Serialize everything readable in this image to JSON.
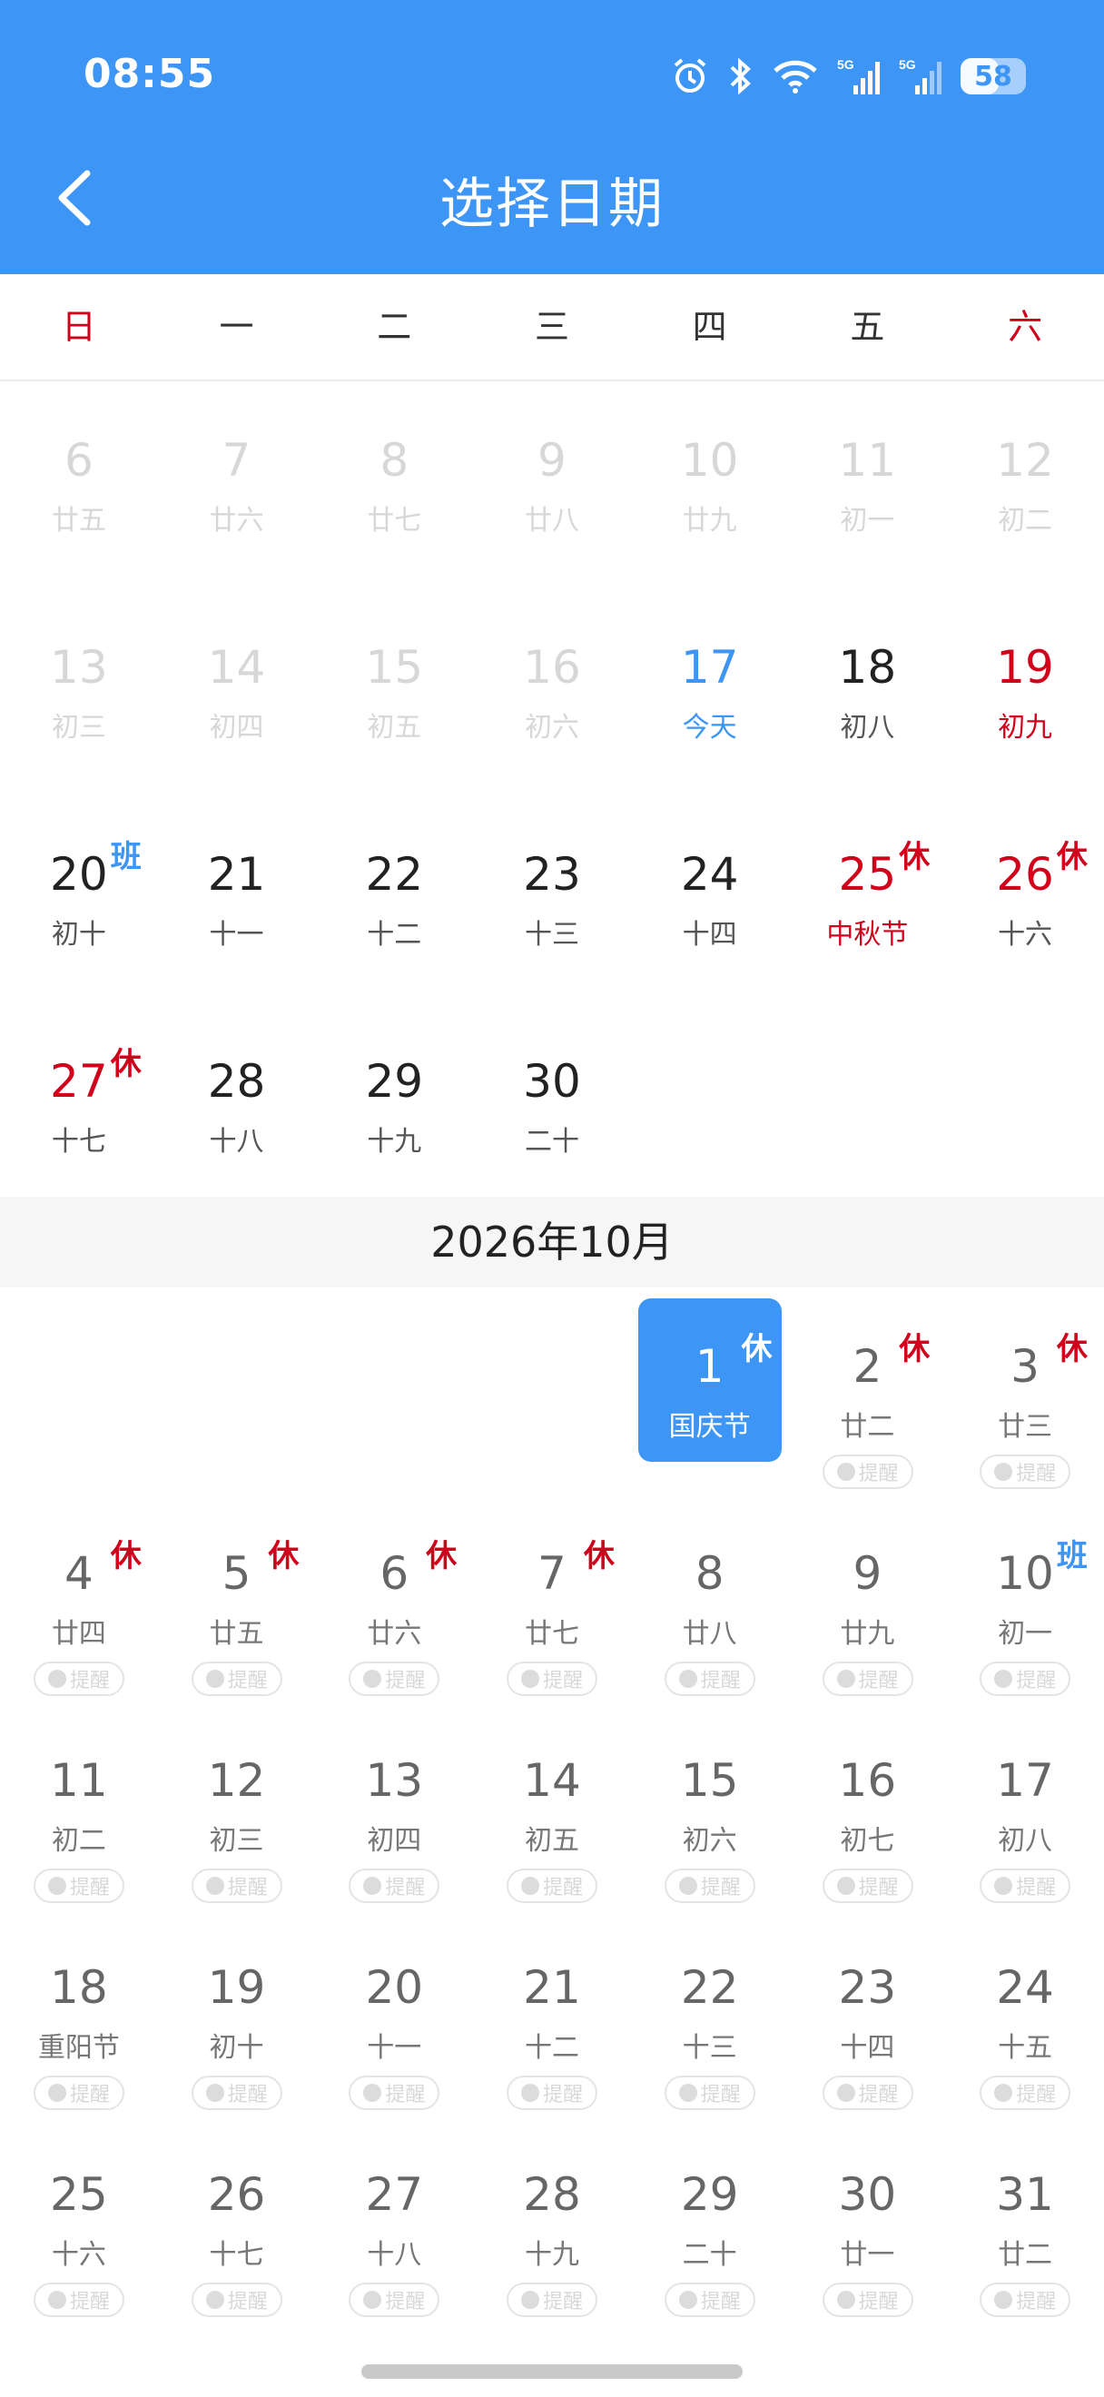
{
  "status_bar": {
    "time": "08:55",
    "battery": "58",
    "battery_fraction": 0.58,
    "signal_label": "5G"
  },
  "header": {
    "title": "选择日期",
    "bg_color": "#3d95f6"
  },
  "weekdays": [
    "日",
    "一",
    "二",
    "三",
    "四",
    "五",
    "六"
  ],
  "tags": {
    "rest": "休",
    "work": "班",
    "remind": "提醒"
  },
  "sept_rows": [
    [
      {
        "day": "6",
        "lunar": "廿五"
      },
      {
        "day": "7",
        "lunar": "廿六"
      },
      {
        "day": "8",
        "lunar": "廿七"
      },
      {
        "day": "9",
        "lunar": "廿八"
      },
      {
        "day": "10",
        "lunar": "廿九"
      },
      {
        "day": "11",
        "lunar": "初一"
      },
      {
        "day": "12",
        "lunar": "初二"
      }
    ],
    [
      {
        "day": "13",
        "lunar": "初三"
      },
      {
        "day": "14",
        "lunar": "初四"
      },
      {
        "day": "15",
        "lunar": "初五"
      },
      {
        "day": "16",
        "lunar": "初六"
      },
      {
        "day": "17",
        "lunar": "今天"
      },
      {
        "day": "18",
        "lunar": "初八"
      },
      {
        "day": "19",
        "lunar": "初九"
      }
    ],
    [
      {
        "day": "20",
        "lunar": "初十"
      },
      {
        "day": "21",
        "lunar": "十一"
      },
      {
        "day": "22",
        "lunar": "十二"
      },
      {
        "day": "23",
        "lunar": "十三"
      },
      {
        "day": "24",
        "lunar": "十四"
      },
      {
        "day": "25",
        "lunar": "中秋节"
      },
      {
        "day": "26",
        "lunar": "十六"
      }
    ],
    [
      {
        "day": "27",
        "lunar": "十七"
      },
      {
        "day": "28",
        "lunar": "十八"
      },
      {
        "day": "29",
        "lunar": "十九"
      },
      {
        "day": "30",
        "lunar": "二十"
      }
    ]
  ],
  "october": {
    "title": "2026年10月",
    "rows": [
      [
        {
          "day": "1",
          "lunar": "国庆节"
        },
        {
          "day": "2",
          "lunar": "廿二"
        },
        {
          "day": "3",
          "lunar": "廿三"
        }
      ],
      [
        {
          "day": "4",
          "lunar": "廿四"
        },
        {
          "day": "5",
          "lunar": "廿五"
        },
        {
          "day": "6",
          "lunar": "廿六"
        },
        {
          "day": "7",
          "lunar": "廿七"
        },
        {
          "day": "8",
          "lunar": "廿八"
        },
        {
          "day": "9",
          "lunar": "廿九"
        },
        {
          "day": "10",
          "lunar": "初一"
        }
      ],
      [
        {
          "day": "11",
          "lunar": "初二"
        },
        {
          "day": "12",
          "lunar": "初三"
        },
        {
          "day": "13",
          "lunar": "初四"
        },
        {
          "day": "14",
          "lunar": "初五"
        },
        {
          "day": "15",
          "lunar": "初六"
        },
        {
          "day": "16",
          "lunar": "初七"
        },
        {
          "day": "17",
          "lunar": "初八"
        }
      ],
      [
        {
          "day": "18",
          "lunar": "重阳节"
        },
        {
          "day": "19",
          "lunar": "初十"
        },
        {
          "day": "20",
          "lunar": "十一"
        },
        {
          "day": "21",
          "lunar": "十二"
        },
        {
          "day": "22",
          "lunar": "十三"
        },
        {
          "day": "23",
          "lunar": "十四"
        },
        {
          "day": "24",
          "lunar": "十五"
        }
      ],
      [
        {
          "day": "25",
          "lunar": "十六"
        },
        {
          "day": "26",
          "lunar": "十七"
        },
        {
          "day": "27",
          "lunar": "十八"
        },
        {
          "day": "28",
          "lunar": "十九"
        },
        {
          "day": "29",
          "lunar": "二十"
        },
        {
          "day": "30",
          "lunar": "廿一"
        },
        {
          "day": "31",
          "lunar": "廿二"
        }
      ]
    ]
  },
  "colors": {
    "accent": "#3d95f6",
    "holiday_red": "#d0021b",
    "faded": "#d7d7d7"
  }
}
